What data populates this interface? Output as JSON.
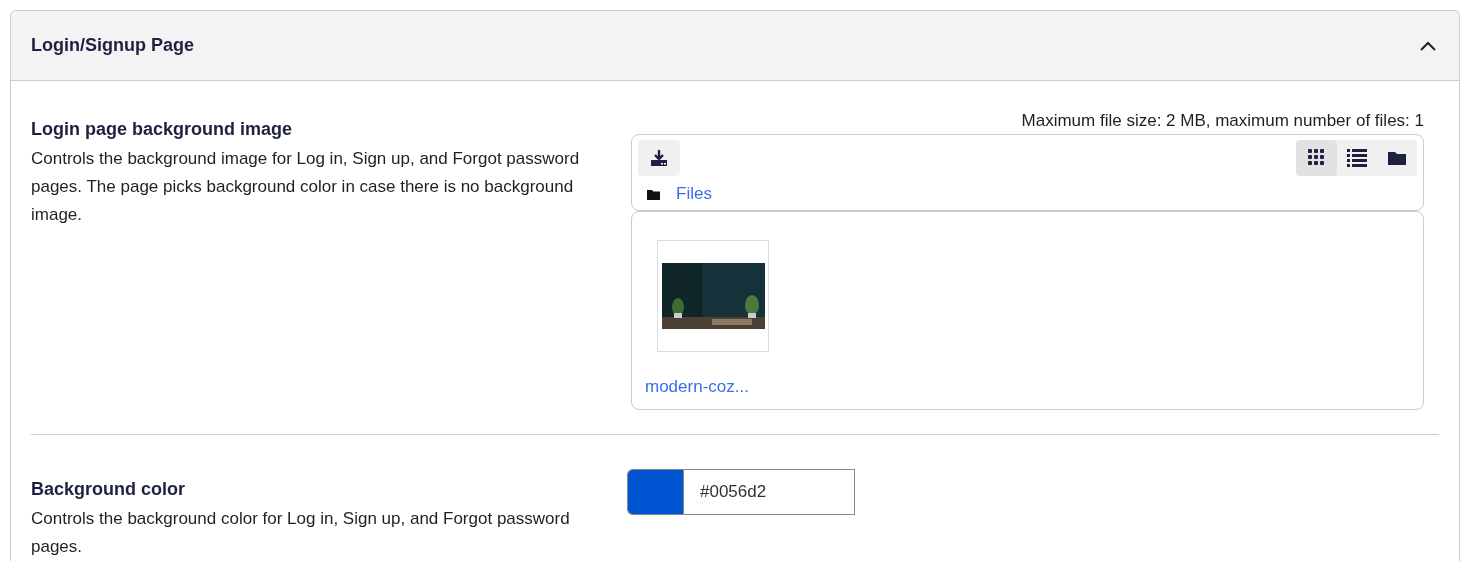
{
  "section": {
    "title": "Login/Signup Page",
    "expanded": true
  },
  "settings": [
    {
      "kind": "filepicker",
      "title": "Login page background image",
      "description": "Controls the background image for Log in, Sign up, and Forgot password pages. The page picks background color in case there is no background image.",
      "limits": "Maximum file size: 2 MB, maximum number of files: 1",
      "breadcrumb": "Files",
      "view_modes": [
        {
          "kind": "grid",
          "selected": true
        },
        {
          "kind": "list",
          "selected": false
        },
        {
          "kind": "tree",
          "selected": false
        }
      ],
      "files": [
        {
          "name": "modern-coz...",
          "kind": "picture"
        }
      ]
    },
    {
      "kind": "color",
      "title": "Background color",
      "description": "Controls the background color for Log in, Sign up, and Forgot password pages.",
      "value": "#0056d2"
    }
  ]
}
